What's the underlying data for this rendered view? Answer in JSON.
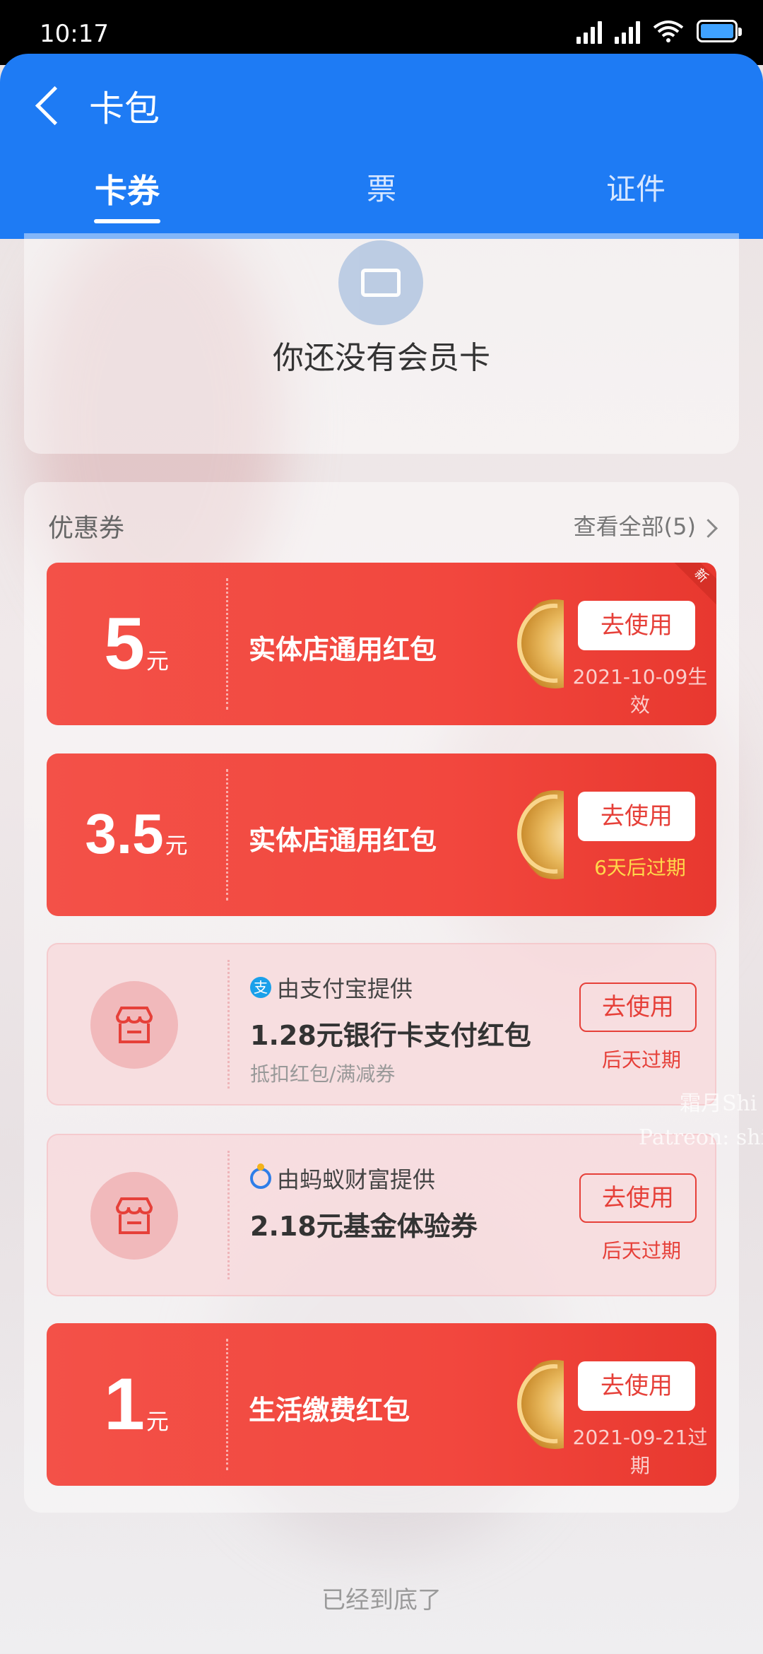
{
  "status_bar": {
    "time": "10:17"
  },
  "header": {
    "title": "卡包",
    "tabs": [
      {
        "label": "卡券",
        "active": true
      },
      {
        "label": "票",
        "active": false
      },
      {
        "label": "证件",
        "active": false
      }
    ]
  },
  "member": {
    "empty_text": "你还没有会员卡"
  },
  "coupons": {
    "section_title": "优惠券",
    "view_all": "查看全部(5)",
    "items": [
      {
        "amount": "5",
        "unit": "元",
        "title": "实体店通用红包",
        "button": "去使用",
        "sub": "2021-10-09生效",
        "new_tag": "新"
      },
      {
        "amount": "3.5",
        "unit": "元",
        "title": "实体店通用红包",
        "button": "去使用",
        "sub": "6天后过期"
      },
      {
        "provider": "由支付宝提供",
        "provider_logo": "支",
        "title": "1.28元银行卡支付红包",
        "desc": "抵扣红包/满减券",
        "button": "去使用",
        "sub": "后天过期"
      },
      {
        "provider": "由蚂蚁财富提供",
        "title": "2.18元基金体验券",
        "button": "去使用",
        "sub": "后天过期"
      },
      {
        "amount": "1",
        "unit": "元",
        "title": "生活缴费红包",
        "button": "去使用",
        "sub": "2021-09-21过期"
      }
    ]
  },
  "footer": {
    "end_text": "已经到底了"
  },
  "watermark": {
    "line1": "霜月Shi",
    "line2": "Patreon: shi"
  },
  "colors": {
    "header_blue": "#1e7bf4",
    "coupon_red": "#f2473e",
    "accent_red": "#e64039",
    "warn_yellow": "#ffd84a"
  }
}
